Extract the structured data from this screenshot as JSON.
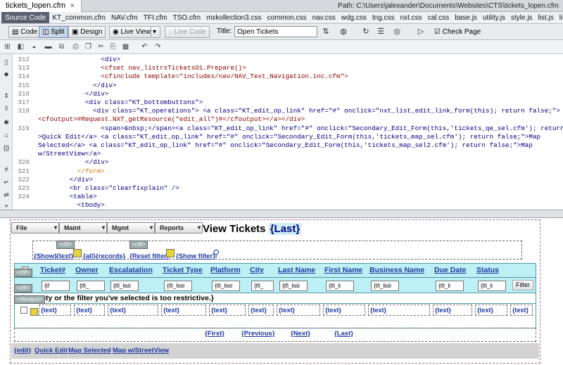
{
  "document": {
    "tab_name": "tickets_lopen.cfm",
    "path_label": "Path:",
    "path_value": "C:\\Users\\jalexander\\Documents\\Websites\\CTS\\tickets_lopen.cfm"
  },
  "related_files": [
    "Source Code",
    "KT_common.cfm",
    "NAV.cfm",
    "TFI.cfm",
    "TSO.cfm",
    "mxkollection3.css",
    "common.css",
    "nav.css",
    "wdg.css",
    "tng.css",
    "nxt.css",
    "cal.css",
    "base.js",
    "utility.js",
    "style.js",
    "list.js",
    "list.js,"
  ],
  "view_toolbar": {
    "code_label": "Code",
    "split_label": "Split",
    "design_label": "Design",
    "live_view_label": "Live View",
    "live_code_label": "Live Code",
    "title_label": "Title:",
    "title_value": "Open Tickets",
    "check_page_label": "Check Page"
  },
  "code": {
    "line_numbers": [
      "312",
      "313",
      "314",
      "315",
      "316",
      "317",
      "318",
      "",
      "319",
      "",
      "",
      "",
      "320",
      "321",
      "322",
      "323",
      "324",
      ""
    ],
    "lines": [
      "                <div>",
      "                <cfset nav_listrsTicketsO1.Prepare()>",
      "                <cfinclude template=\"includes/nav/NAV_Text_Navigation.inc.cfm\">",
      "              </div>",
      "            </div>",
      "            <div class=\"KT_bottombuttons\">",
      "              <div class=\"KT_operations\"> <a class=\"KT_edit_op_link\" href=\"#\" onclick=\"nxt_list_edit_link_form(this); return false;\">",
      "<cfoutput>#Request.NXT_getResource(\"edit_all\")#</cfoutput></a></div>",
      "                <span>&nbsp;</span><a class=\"KT_edit_op_link\" href=\"#\" onclick=\"Secondary_Edit_Form(this,'tickets_qe_sel.cfm'); return false;\"",
      ">Quick Edit</a> <a class=\"KT_edit_op_link\" href=\"#\" onclick=\"Secondary_Edit_Form(this,'tickets_map_sel.cfm'); return false;\">Map",
      "Selected</a> <a class=\"KT_edit_op_link\" href=\"#\" onclick=\"Secondary_Edit_Form(this,'tickets_map_sel2.cfm'); return false;\">Map",
      "w/StreetView</a>",
      "            </div>",
      "          </form>",
      "        </div>",
      "        <br class=\"clearfixplain\" />",
      "        <table>",
      "          <tbody>"
    ]
  },
  "design": {
    "menus": [
      "File",
      "Maint",
      "Mgmt",
      "Reports"
    ],
    "title_text": "View Tickets",
    "title_dynamic": "{Last}",
    "cfif_tag": "<cfif>",
    "cfoutput_tag": "<cfoutput>",
    "filter_links": {
      "show": "{Show}",
      "text": "{text}",
      "all": "{all}",
      "records": "{records}",
      "reset_filter": "{Reset filter}",
      "show_filter": "{Show filter}"
    },
    "columns": [
      "Ticket#",
      "Owner",
      "Escalatation",
      "Ticket Type",
      "Platform",
      "City",
      "Last Name",
      "First Name",
      "Business Name",
      "Due Date",
      "Status"
    ],
    "filter_inputs": [
      "{tf",
      "{tfi_",
      "{tfi_listi",
      "{tfi_listr",
      "{tfi_listr",
      "{tfi_",
      "{tfi_listi",
      "{tfi_li",
      "{tfi_listi",
      "{tfi_li",
      "{tfi_li"
    ],
    "filter_button": "Filter",
    "empty_message": "e is empty or the filter you've selected is too restrictive.}",
    "row_text": "{text}",
    "pager": [
      "{First}",
      "{Previous}",
      "{Next}",
      "{Last}"
    ],
    "bottom_links": [
      "{edit}",
      "Quick Edit",
      "Map Selected",
      "Map w/StreetView"
    ]
  }
}
